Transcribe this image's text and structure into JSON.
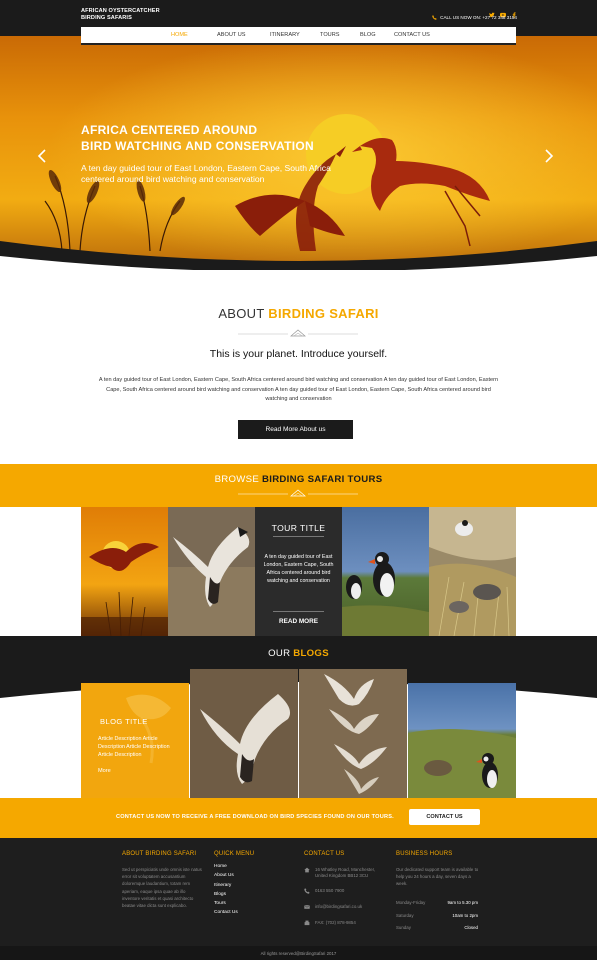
{
  "header": {
    "brand_line1": "AFRICAN OYSTERCATCHER",
    "brand_line2": "BIRDING SAFARIS",
    "phone": "CALL US NOW ON: +27 72 348 3154",
    "social": [
      "twitter-icon",
      "youtube-icon",
      "facebook-icon"
    ],
    "nav": [
      "HOME",
      "ABOUT US",
      "ITINERARY",
      "TOURS",
      "BLOG",
      "CONTACT US"
    ],
    "active_nav": "HOME"
  },
  "hero": {
    "title_line1": "AFRICA CENTERED AROUND",
    "title_line2": "BIRD WATCHING AND CONSERVATION",
    "subtitle": "A ten day guided tour of East London, Eastern Cape, South Africa centered around bird watching and conservation"
  },
  "about": {
    "heading_plain": "ABOUT",
    "heading_accent": "BIRDING SAFARI",
    "intro": "This is your planet. Introduce yourself.",
    "body": "A ten day guided tour of East London, Eastern Cape, South Africa centered around bird watching and conservation A ten day guided tour of East London, Eastern Cape, South Africa centered around bird watching and conservation A ten day guided tour of East London, Eastern Cape, South Africa centered around bird watching and conservation",
    "button": "Read More About us"
  },
  "tours": {
    "heading_plain": "BROWSE",
    "heading_accent": "BIRDING SAFARI TOURS",
    "card_title": "TOUR TITLE",
    "card_desc": "A ten day guided tour of East London, Eastern Cape, South Africa centered around bird watching and conservation",
    "card_more": "READ MORE"
  },
  "blogs": {
    "heading_plain": "OUR",
    "heading_accent": "BLOGS",
    "card_title": "BLOG TITLE",
    "card_desc": "Article Description Article Description  Article Description Article Description",
    "card_more": "More"
  },
  "cta": {
    "text": "CONTACT US NOW TO RECEIVE A FREE DOWNLOAD ON BIRD SPECIES FOUND ON OUR TOURS.",
    "button": "CONTACT US"
  },
  "footer": {
    "about_heading": "ABOUT BIRDING SAFARI",
    "about_text": "Sed ut perspiciatis unde omnis iste natus error sit voluptatem accusantium doloremque laudantium, totam rem aperiam, eaque ipsa quae ab illo inventore veritatis et quasi architecto beatae vitae dicta sunt explicabo.",
    "menu_heading": "QUICK MENU",
    "menu": [
      "Home",
      "About Us",
      "Itinerary",
      "Blogs",
      "Tours",
      "Contact Us"
    ],
    "contact_heading": "CONTACT US",
    "address": "16 Whatley Road, Manchester, United Kingdom BB12 3CU",
    "phone": "0163 550 7900",
    "email": "info@birdingsafari.co.uk",
    "fax": "FAX: (702) 878-9854",
    "hours_heading": "BUSINESS HOURS",
    "hours_text": "Our dedicated support team is available to help you 24 hours a day, seven days a week.",
    "hours": [
      {
        "day": "Monday-Friday",
        "time": "9am to 5.30 pm"
      },
      {
        "day": "Saturday",
        "time": "10am to 2pm"
      },
      {
        "day": "Sunday",
        "time": "Closed"
      }
    ],
    "copyright": "All rights reserved@BirdingSafari 2017"
  },
  "colors": {
    "accent": "#f5a800",
    "dark": "#1b1b1b"
  }
}
